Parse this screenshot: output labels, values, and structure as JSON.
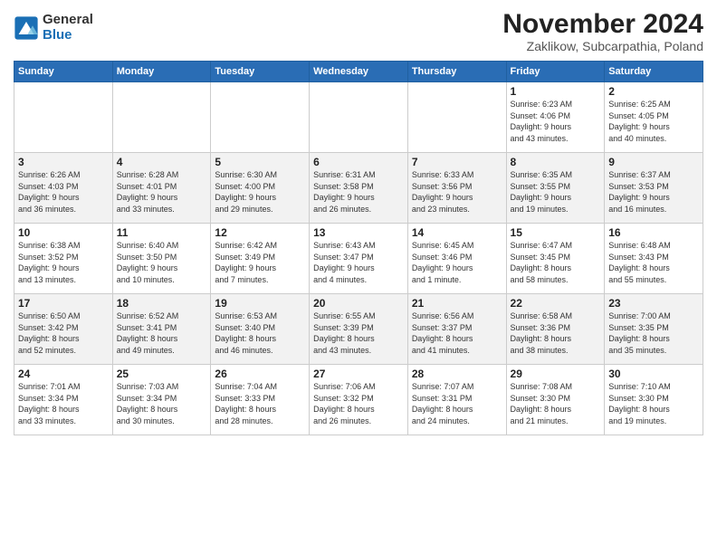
{
  "logo": {
    "general": "General",
    "blue": "Blue"
  },
  "title": "November 2024",
  "subtitle": "Zaklikow, Subcarpathia, Poland",
  "headers": [
    "Sunday",
    "Monday",
    "Tuesday",
    "Wednesday",
    "Thursday",
    "Friday",
    "Saturday"
  ],
  "weeks": [
    [
      {
        "day": "",
        "info": ""
      },
      {
        "day": "",
        "info": ""
      },
      {
        "day": "",
        "info": ""
      },
      {
        "day": "",
        "info": ""
      },
      {
        "day": "",
        "info": ""
      },
      {
        "day": "1",
        "info": "Sunrise: 6:23 AM\nSunset: 4:06 PM\nDaylight: 9 hours\nand 43 minutes."
      },
      {
        "day": "2",
        "info": "Sunrise: 6:25 AM\nSunset: 4:05 PM\nDaylight: 9 hours\nand 40 minutes."
      }
    ],
    [
      {
        "day": "3",
        "info": "Sunrise: 6:26 AM\nSunset: 4:03 PM\nDaylight: 9 hours\nand 36 minutes."
      },
      {
        "day": "4",
        "info": "Sunrise: 6:28 AM\nSunset: 4:01 PM\nDaylight: 9 hours\nand 33 minutes."
      },
      {
        "day": "5",
        "info": "Sunrise: 6:30 AM\nSunset: 4:00 PM\nDaylight: 9 hours\nand 29 minutes."
      },
      {
        "day": "6",
        "info": "Sunrise: 6:31 AM\nSunset: 3:58 PM\nDaylight: 9 hours\nand 26 minutes."
      },
      {
        "day": "7",
        "info": "Sunrise: 6:33 AM\nSunset: 3:56 PM\nDaylight: 9 hours\nand 23 minutes."
      },
      {
        "day": "8",
        "info": "Sunrise: 6:35 AM\nSunset: 3:55 PM\nDaylight: 9 hours\nand 19 minutes."
      },
      {
        "day": "9",
        "info": "Sunrise: 6:37 AM\nSunset: 3:53 PM\nDaylight: 9 hours\nand 16 minutes."
      }
    ],
    [
      {
        "day": "10",
        "info": "Sunrise: 6:38 AM\nSunset: 3:52 PM\nDaylight: 9 hours\nand 13 minutes."
      },
      {
        "day": "11",
        "info": "Sunrise: 6:40 AM\nSunset: 3:50 PM\nDaylight: 9 hours\nand 10 minutes."
      },
      {
        "day": "12",
        "info": "Sunrise: 6:42 AM\nSunset: 3:49 PM\nDaylight: 9 hours\nand 7 minutes."
      },
      {
        "day": "13",
        "info": "Sunrise: 6:43 AM\nSunset: 3:47 PM\nDaylight: 9 hours\nand 4 minutes."
      },
      {
        "day": "14",
        "info": "Sunrise: 6:45 AM\nSunset: 3:46 PM\nDaylight: 9 hours\nand 1 minute."
      },
      {
        "day": "15",
        "info": "Sunrise: 6:47 AM\nSunset: 3:45 PM\nDaylight: 8 hours\nand 58 minutes."
      },
      {
        "day": "16",
        "info": "Sunrise: 6:48 AM\nSunset: 3:43 PM\nDaylight: 8 hours\nand 55 minutes."
      }
    ],
    [
      {
        "day": "17",
        "info": "Sunrise: 6:50 AM\nSunset: 3:42 PM\nDaylight: 8 hours\nand 52 minutes."
      },
      {
        "day": "18",
        "info": "Sunrise: 6:52 AM\nSunset: 3:41 PM\nDaylight: 8 hours\nand 49 minutes."
      },
      {
        "day": "19",
        "info": "Sunrise: 6:53 AM\nSunset: 3:40 PM\nDaylight: 8 hours\nand 46 minutes."
      },
      {
        "day": "20",
        "info": "Sunrise: 6:55 AM\nSunset: 3:39 PM\nDaylight: 8 hours\nand 43 minutes."
      },
      {
        "day": "21",
        "info": "Sunrise: 6:56 AM\nSunset: 3:37 PM\nDaylight: 8 hours\nand 41 minutes."
      },
      {
        "day": "22",
        "info": "Sunrise: 6:58 AM\nSunset: 3:36 PM\nDaylight: 8 hours\nand 38 minutes."
      },
      {
        "day": "23",
        "info": "Sunrise: 7:00 AM\nSunset: 3:35 PM\nDaylight: 8 hours\nand 35 minutes."
      }
    ],
    [
      {
        "day": "24",
        "info": "Sunrise: 7:01 AM\nSunset: 3:34 PM\nDaylight: 8 hours\nand 33 minutes."
      },
      {
        "day": "25",
        "info": "Sunrise: 7:03 AM\nSunset: 3:34 PM\nDaylight: 8 hours\nand 30 minutes."
      },
      {
        "day": "26",
        "info": "Sunrise: 7:04 AM\nSunset: 3:33 PM\nDaylight: 8 hours\nand 28 minutes."
      },
      {
        "day": "27",
        "info": "Sunrise: 7:06 AM\nSunset: 3:32 PM\nDaylight: 8 hours\nand 26 minutes."
      },
      {
        "day": "28",
        "info": "Sunrise: 7:07 AM\nSunset: 3:31 PM\nDaylight: 8 hours\nand 24 minutes."
      },
      {
        "day": "29",
        "info": "Sunrise: 7:08 AM\nSunset: 3:30 PM\nDaylight: 8 hours\nand 21 minutes."
      },
      {
        "day": "30",
        "info": "Sunrise: 7:10 AM\nSunset: 3:30 PM\nDaylight: 8 hours\nand 19 minutes."
      }
    ]
  ]
}
